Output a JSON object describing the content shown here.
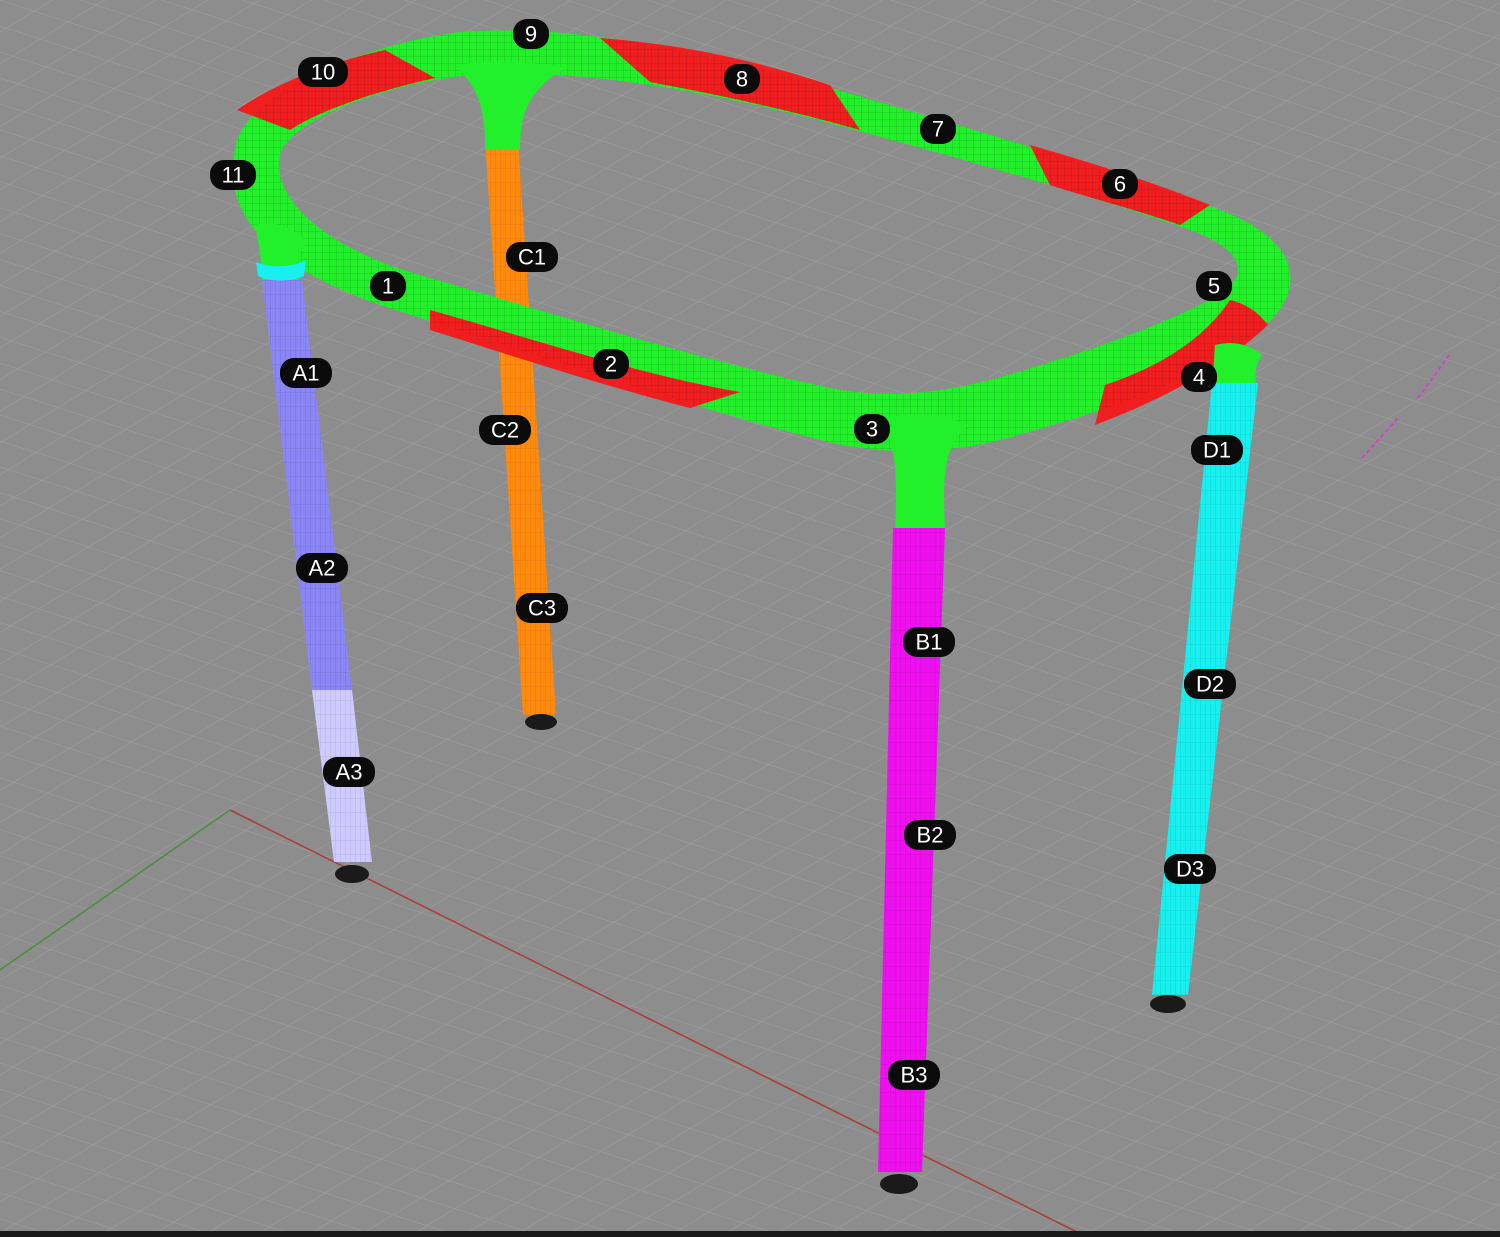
{
  "viewport": {
    "background": "#8d8d8d",
    "grid_color": "#a0a0a0",
    "axis_x_color": "#a8403a",
    "axis_y_color": "#4c8f3a"
  },
  "colors": {
    "frame_green": "#22f02a",
    "frame_red": "#f01e1e",
    "leg_a": "#8b86f5",
    "leg_a3": "#cfcaff",
    "leg_b": "#ef10ef",
    "leg_c": "#ff8a0e",
    "leg_d": "#18f0f0",
    "foot": "#1a1a1a",
    "label_bg": "#0b0b0b",
    "label_text": "#ffffff"
  },
  "labels": {
    "ring_1": "1",
    "ring_2": "2",
    "ring_3": "3",
    "ring_4": "4",
    "ring_5": "5",
    "ring_6": "6",
    "ring_7": "7",
    "ring_8": "8",
    "ring_9": "9",
    "ring_10": "10",
    "ring_11": "11",
    "a1": "A1",
    "a2": "A2",
    "a3": "A3",
    "b1": "B1",
    "b2": "B2",
    "b3": "B3",
    "c1": "C1",
    "c2": "C2",
    "c3": "C3",
    "d1": "D1",
    "d2": "D2",
    "d3": "D3"
  }
}
